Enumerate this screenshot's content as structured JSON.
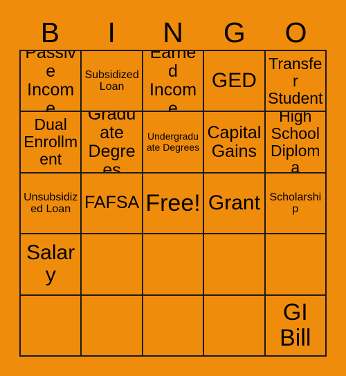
{
  "card": {
    "title_letters": [
      "B",
      "I",
      "N",
      "G",
      "O"
    ],
    "background_color": "#f08c0c",
    "text_color": "#000000",
    "grid_line_color": "#1a1a1a",
    "columns": 5,
    "rows": 5,
    "free_space_label": "Free!",
    "free_space_position": "row3-col3"
  },
  "cells": [
    {
      "id": "r1c1",
      "text": "Passive Income",
      "size": "lg",
      "empty": false
    },
    {
      "id": "r1c2",
      "text": "Subsidized Loan",
      "size": "sm",
      "empty": false
    },
    {
      "id": "r1c3",
      "text": "Earned Income",
      "size": "lg",
      "empty": false
    },
    {
      "id": "r1c4",
      "text": "GED",
      "size": "xl",
      "empty": false
    },
    {
      "id": "r1c5",
      "text": "Transfer Student",
      "size": "md",
      "empty": false
    },
    {
      "id": "r2c1",
      "text": "Dual Enrollment",
      "size": "md",
      "empty": false
    },
    {
      "id": "r2c2",
      "text": "Graduate Degrees",
      "size": "lg",
      "empty": false
    },
    {
      "id": "r2c3",
      "text": "Undergraduate Degrees",
      "size": "xs",
      "empty": false
    },
    {
      "id": "r2c4",
      "text": "Capital Gains",
      "size": "lg",
      "empty": false
    },
    {
      "id": "r2c5",
      "text": "High School Diploma",
      "size": "md",
      "empty": false
    },
    {
      "id": "r3c1",
      "text": "Unsubsidized Loan",
      "size": "sm",
      "empty": false
    },
    {
      "id": "r3c2",
      "text": "FAFSA",
      "size": "lg",
      "empty": false
    },
    {
      "id": "r3c3",
      "text": "Free!",
      "size": "xxl",
      "empty": false
    },
    {
      "id": "r3c4",
      "text": "Grant",
      "size": "xl",
      "empty": false
    },
    {
      "id": "r3c5",
      "text": "Scholarship",
      "size": "sm",
      "empty": false
    },
    {
      "id": "r4c1",
      "text": "Salary",
      "size": "xl",
      "empty": false
    },
    {
      "id": "r4c2",
      "text": "",
      "size": "md",
      "empty": true
    },
    {
      "id": "r4c3",
      "text": "",
      "size": "md",
      "empty": true
    },
    {
      "id": "r4c4",
      "text": "",
      "size": "md",
      "empty": true
    },
    {
      "id": "r4c5",
      "text": "",
      "size": "md",
      "empty": true
    },
    {
      "id": "r5c1",
      "text": "",
      "size": "md",
      "empty": true
    },
    {
      "id": "r5c2",
      "text": "",
      "size": "md",
      "empty": true
    },
    {
      "id": "r5c3",
      "text": "",
      "size": "md",
      "empty": true
    },
    {
      "id": "r5c4",
      "text": "",
      "size": "md",
      "empty": true
    },
    {
      "id": "r5c5",
      "text": "GI Bill",
      "size": "xxl",
      "empty": false
    }
  ]
}
